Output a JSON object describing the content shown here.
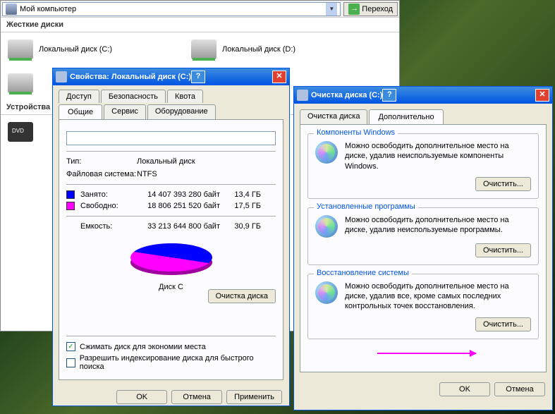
{
  "explorer": {
    "address": "Мой компьютер",
    "go_label": "Переход",
    "section_hdd": "Жесткие диски",
    "section_removable": "Устройства",
    "drives": [
      {
        "label": "Локальный диск (C:)"
      },
      {
        "label": "Локальный диск (D:)"
      }
    ]
  },
  "props": {
    "title": "Свойства: Локальный диск (C:)",
    "tabs_row1": [
      "Доступ",
      "Безопасность",
      "Квота"
    ],
    "tabs_row2": [
      "Общие",
      "Сервис",
      "Оборудование"
    ],
    "active_tab": "Общие",
    "type_label": "Тип:",
    "type_value": "Локальный диск",
    "fs_label": "Файловая система:",
    "fs_value": "NTFS",
    "used_label": "Занято:",
    "used_bytes": "14 407 393 280 байт",
    "used_gb": "13,4 ГБ",
    "free_label": "Свободно:",
    "free_bytes": "18 806 251 520 байт",
    "free_gb": "17,5 ГБ",
    "cap_label": "Емкость:",
    "cap_bytes": "33 213 644 800 байт",
    "cap_gb": "30,9 ГБ",
    "disk_label": "Диск C",
    "cleanup_btn": "Очистка диска",
    "compress_check": "Сжимать диск для экономии места",
    "index_check": "Разрешить индексирование диска для быстрого поиска",
    "ok": "OK",
    "cancel": "Отмена",
    "apply": "Применить",
    "colors": {
      "used": "#0000ff",
      "free": "#ff00ff"
    }
  },
  "cleanup": {
    "title": "Очистка диска  (C:)",
    "tabs": [
      "Очистка диска",
      "Дополнительно"
    ],
    "active_tab": "Дополнительно",
    "sections": [
      {
        "legend": "Компоненты Windows",
        "text": "Можно освободить дополнительное место на диске, удалив неиспользуемые компоненты Windows.",
        "btn": "Очистить..."
      },
      {
        "legend": "Установленные программы",
        "text": "Можно освободить дополнительное место на диске, удалив неиспользуемые программы.",
        "btn": "Очистить..."
      },
      {
        "legend": "Восстановление системы",
        "text": "Можно освободить дополнительное место на диске, удалив все, кроме самых последних контрольных точек восстановления.",
        "btn": "Очистить..."
      }
    ],
    "ok": "OK",
    "cancel": "Отмена"
  },
  "chart_data": {
    "type": "pie",
    "title": "Диск C",
    "series": [
      {
        "name": "Занято",
        "value_bytes": 14407393280,
        "value_gb": 13.4,
        "color": "#0000ff"
      },
      {
        "name": "Свободно",
        "value_bytes": 18806251520,
        "value_gb": 17.5,
        "color": "#ff00ff"
      }
    ],
    "total_bytes": 33213644800,
    "total_gb": 30.9
  }
}
